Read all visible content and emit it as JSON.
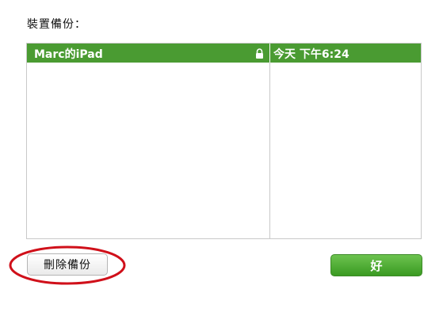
{
  "dialog": {
    "section_label": "裝置備份："
  },
  "backups": {
    "rows": [
      {
        "device_name": "Marc的iPad",
        "locked_icon": "lock-icon",
        "date": "今天 下午6:24",
        "selected": true
      }
    ]
  },
  "buttons": {
    "delete_label": "刪除備份",
    "ok_label": "好"
  },
  "colors": {
    "selection": "#4a9b32",
    "ok_button": "#4caf34",
    "annotation_circle": "#d0101a"
  }
}
